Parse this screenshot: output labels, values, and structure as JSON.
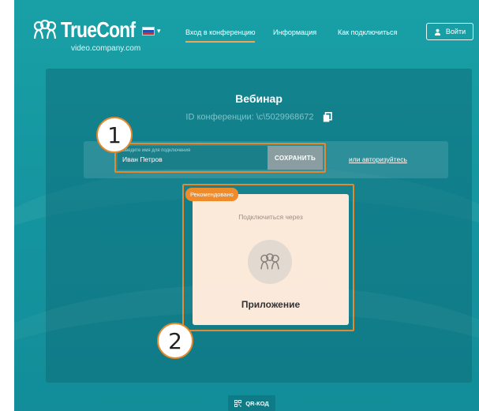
{
  "header": {
    "logo_text": "TrueConf",
    "domain": "video.company.com",
    "language_flag_colors": [
      "#ffffff",
      "#2350b5",
      "#d82a2a"
    ],
    "nav": [
      {
        "label": "Вход в конференцию",
        "active": true
      },
      {
        "label": "Информация",
        "active": false
      },
      {
        "label": "Как подключиться",
        "active": false
      }
    ],
    "login_label": "Войти"
  },
  "conference": {
    "title": "Вебинар",
    "id_text": "ID конференции: \\c\\5029968672"
  },
  "name_form": {
    "label": "Введите имя для подключения",
    "value": "Иван Петров",
    "save_label": "СОХРАНИТЬ",
    "or_login": "или авторизуйтесь"
  },
  "join_option": {
    "badge": "Рекомендовано",
    "subtitle": "Подключиться через",
    "name": "Приложение",
    "icon": "trueconf-app-icon"
  },
  "qr_label": "QR-КОД",
  "callouts": [
    "1",
    "2"
  ],
  "colors": {
    "background": "#1596a0",
    "accent": "#e4892e",
    "badge": "#f08b2c",
    "card": "#fbe9da"
  }
}
